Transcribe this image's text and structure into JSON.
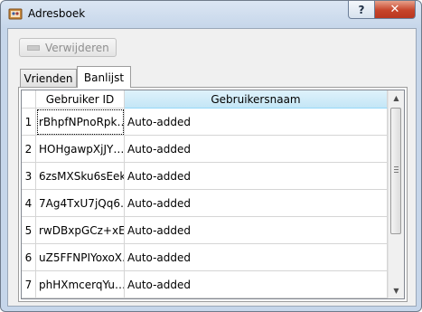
{
  "window": {
    "title": "Adresboek",
    "help_label": "?",
    "close_label": "✕"
  },
  "toolbar": {
    "remove_label": "Verwijderen"
  },
  "tabs": [
    {
      "label": "Vrienden"
    },
    {
      "label": "Banlijst"
    }
  ],
  "active_tab": "Banlijst",
  "table": {
    "columns": [
      "Gebruiker ID",
      "Gebruikersnaam"
    ],
    "rows": [
      {
        "num": "1",
        "id": "rBhpfNPnoRpk…",
        "name": "Auto-added"
      },
      {
        "num": "2",
        "id": "HOHgawpXjJY…",
        "name": "Auto-added"
      },
      {
        "num": "3",
        "id": "6zsMXSku6sEek…",
        "name": "Auto-added"
      },
      {
        "num": "4",
        "id": "7Ag4TxU7jQq6…",
        "name": "Auto-added"
      },
      {
        "num": "5",
        "id": "rwDBxpGCz+xE…",
        "name": "Auto-added"
      },
      {
        "num": "6",
        "id": "uZ5FFNPIYoxoX…",
        "name": "Auto-added"
      },
      {
        "num": "7",
        "id": "phHXmcerqYu…",
        "name": "Auto-added"
      }
    ]
  },
  "icons": {
    "app": "address-book-icon",
    "help": "help-icon",
    "close": "close-icon",
    "remove": "remove-icon",
    "scroll_up": "scroll-up-arrow-icon",
    "scroll_down": "scroll-down-arrow-icon"
  }
}
